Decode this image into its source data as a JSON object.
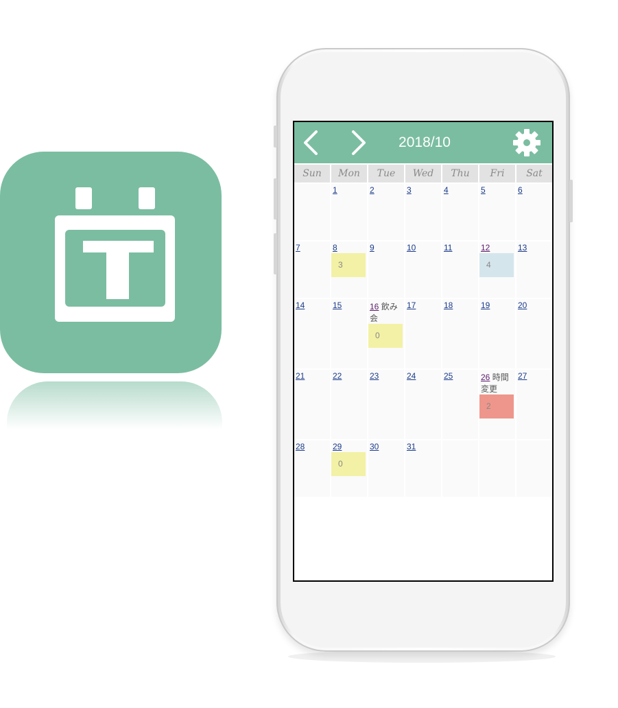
{
  "colors": {
    "accent": "#7bbda1",
    "event_yellow": "#f3f1a5",
    "event_blue": "#d5e5ec",
    "event_red": "#ee968c"
  },
  "icons": {
    "app": "calendar-t-icon",
    "prev": "chevron-left-icon",
    "next": "chevron-right-icon",
    "settings": "gear-icon"
  },
  "header": {
    "title": "2018/10"
  },
  "weekdays": [
    "Sun",
    "Mon",
    "Tue",
    "Wed",
    "Thu",
    "Fri",
    "Sat"
  ],
  "weeks": [
    {
      "height": 82,
      "days": [
        {
          "day": ""
        },
        {
          "day": "1"
        },
        {
          "day": "2"
        },
        {
          "day": "3"
        },
        {
          "day": "4"
        },
        {
          "day": "5"
        },
        {
          "day": "6"
        }
      ]
    },
    {
      "height": 82,
      "days": [
        {
          "day": "7"
        },
        {
          "day": "8",
          "event": {
            "count": "3",
            "color": "yellow"
          }
        },
        {
          "day": "9"
        },
        {
          "day": "10"
        },
        {
          "day": "11"
        },
        {
          "day": "12",
          "event": {
            "count": "4",
            "color": "blue"
          },
          "visited": true
        },
        {
          "day": "13"
        }
      ]
    },
    {
      "height": 101,
      "days": [
        {
          "day": "14"
        },
        {
          "day": "15"
        },
        {
          "day": "16",
          "note": "飲み会",
          "event": {
            "count": "0",
            "color": "yellow"
          },
          "visited": true
        },
        {
          "day": "17"
        },
        {
          "day": "18"
        },
        {
          "day": "19"
        },
        {
          "day": "20"
        }
      ]
    },
    {
      "height": 101,
      "days": [
        {
          "day": "21"
        },
        {
          "day": "22"
        },
        {
          "day": "23"
        },
        {
          "day": "24"
        },
        {
          "day": "25"
        },
        {
          "day": "26",
          "note": "時間変更",
          "event": {
            "count": "2",
            "color": "red"
          },
          "visited": true
        },
        {
          "day": "27"
        }
      ]
    },
    {
      "height": 82,
      "days": [
        {
          "day": "28"
        },
        {
          "day": "29",
          "event": {
            "count": "0",
            "color": "yellow"
          }
        },
        {
          "day": "30"
        },
        {
          "day": "31"
        },
        {
          "day": ""
        },
        {
          "day": ""
        },
        {
          "day": ""
        }
      ]
    }
  ]
}
